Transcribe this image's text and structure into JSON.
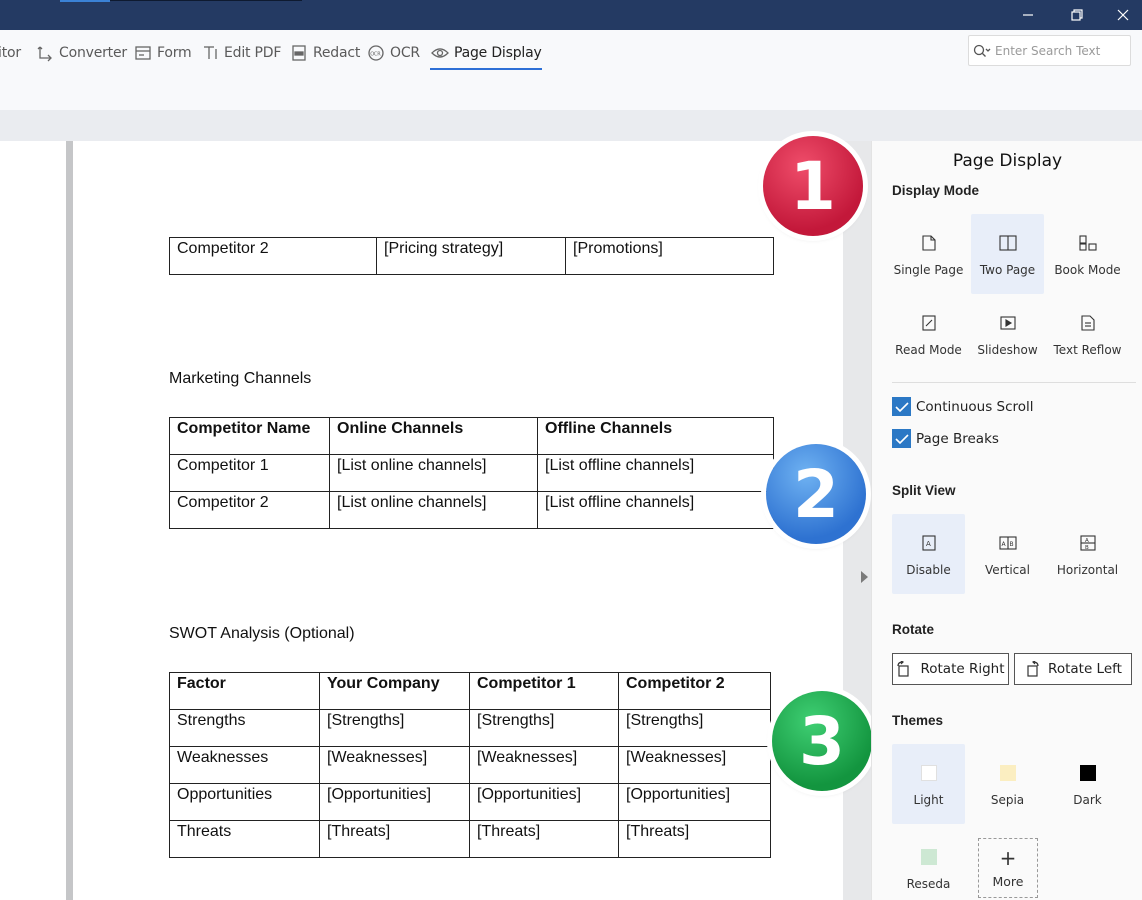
{
  "toolbar": {
    "items": [
      {
        "label": "itor",
        "icon": "editor-icon"
      },
      {
        "label": "Converter",
        "icon": "converter-icon"
      },
      {
        "label": "Form",
        "icon": "form-icon"
      },
      {
        "label": "Edit PDF",
        "icon": "edit-pdf-icon"
      },
      {
        "label": "Redact",
        "icon": "redact-icon"
      },
      {
        "label": "OCR",
        "icon": "ocr-icon"
      },
      {
        "label": "Page Display",
        "icon": "eye-icon",
        "active": true
      }
    ],
    "search_placeholder": "Enter Search Text"
  },
  "document": {
    "table_pricing": {
      "rows": [
        [
          "Competitor 2",
          "[Pricing strategy]",
          "[Promotions]"
        ]
      ]
    },
    "marketing_heading": "Marketing Channels",
    "table_marketing": {
      "headers": [
        "Competitor Name",
        "Online Channels",
        "Offline Channels"
      ],
      "rows": [
        [
          "Competitor 1",
          "[List online channels]",
          "[List offline channels]"
        ],
        [
          "Competitor 2",
          "[List online channels]",
          "[List offline channels]"
        ]
      ]
    },
    "swot_heading": "SWOT Analysis (Optional)",
    "table_swot": {
      "headers": [
        "Factor",
        "Your Company",
        "Competitor 1",
        "Competitor 2"
      ],
      "rows": [
        [
          "Strengths",
          "[Strengths]",
          "[Strengths]",
          "[Strengths]"
        ],
        [
          "Weaknesses",
          "[Weaknesses]",
          "[Weaknesses]",
          "[Weaknesses]"
        ],
        [
          "Opportunities",
          "[Opportunities]",
          "[Opportunities]",
          "[Opportunities]"
        ],
        [
          "Threats",
          "[Threats]",
          "[Threats]",
          "[Threats]"
        ]
      ]
    }
  },
  "badges": [
    "1",
    "2",
    "3"
  ],
  "panel": {
    "title": "Page Display",
    "display_mode": {
      "title": "Display Mode",
      "options": [
        {
          "label": "Single Page",
          "icon": "single-page-icon",
          "selected": false
        },
        {
          "label": "Two Page",
          "icon": "two-page-icon",
          "selected": true
        },
        {
          "label": "Book Mode",
          "icon": "book-mode-icon",
          "selected": false
        },
        {
          "label": "Read Mode",
          "icon": "read-mode-icon",
          "selected": false
        },
        {
          "label": "Slideshow",
          "icon": "slideshow-icon",
          "selected": false
        },
        {
          "label": "Text Reflow",
          "icon": "text-reflow-icon",
          "selected": false
        }
      ]
    },
    "continuous_scroll": {
      "label": "Continuous Scroll",
      "checked": true
    },
    "page_breaks": {
      "label": "Page Breaks",
      "checked": true
    },
    "split_view": {
      "title": "Split View",
      "options": [
        {
          "label": "Disable",
          "icon": "split-disable-icon",
          "selected": true
        },
        {
          "label": "Vertical",
          "icon": "split-vertical-icon",
          "selected": false
        },
        {
          "label": "Horizontal",
          "icon": "split-horizontal-icon",
          "selected": false
        }
      ]
    },
    "rotate": {
      "title": "Rotate",
      "right_label": "Rotate Right",
      "left_label": "Rotate Left"
    },
    "themes": {
      "title": "Themes",
      "options": [
        {
          "label": "Light",
          "color": "#ffffff",
          "selected": true
        },
        {
          "label": "Sepia",
          "color": "#fbeec1",
          "selected": false
        },
        {
          "label": "Dark",
          "color": "#000000",
          "selected": false
        },
        {
          "label": "Reseda",
          "color": "#cde8d3",
          "selected": false
        }
      ],
      "more_label": "More"
    }
  },
  "colors": {
    "titlebar": "#243a63",
    "accent": "#2d6fd6",
    "checkbox": "#2b78c5",
    "selected_bg": "#e8eef9"
  }
}
